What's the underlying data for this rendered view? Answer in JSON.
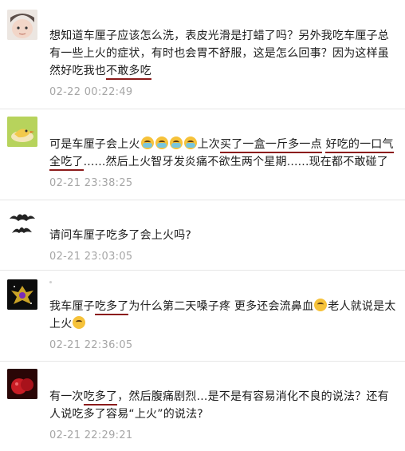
{
  "comments": [
    {
      "avatar": "baby-photo-avatar",
      "segments": [
        {
          "t": "想知道车厘子应该怎么洗，表皮光滑是打蜡了吗？另外我吃车厘子总有一些上火的症状，有时也会胃不舒服，这是怎么回事？因为这样虽然好吃我也"
        },
        {
          "t": "不敢多吃",
          "u": true
        }
      ],
      "time": "02-22 00:22:49"
    },
    {
      "avatar": "cartoon-bird-avatar",
      "segments": [
        {
          "t": "可是车厘子会上火"
        },
        {
          "emoji": "crying-face-icon"
        },
        {
          "emoji": "crying-face-icon"
        },
        {
          "emoji": "crying-face-icon"
        },
        {
          "emoji": "crying-face-icon"
        },
        {
          "t": "上次"
        },
        {
          "t": "买了一盒一斤多一点",
          "u": true
        },
        {
          "t": " "
        },
        {
          "t": "好吃的一口气全吃了",
          "u": true
        },
        {
          "t": "......然后上火智牙发炎痛不欲生两个星期......现在都不敢碰了"
        }
      ],
      "time": "02-21 23:38:25"
    },
    {
      "avatar": "bat-avatar",
      "segments": [
        {
          "t": "请问车厘子吃多了会上火吗?"
        }
      ],
      "time": "02-21 23:03:05"
    },
    {
      "avatar": "dark-emblem-avatar",
      "segments": [
        {
          "t": "我车厘子"
        },
        {
          "t": "吃多了",
          "u": true
        },
        {
          "t": "为什么第二天嗓子疼 更多还会流鼻血"
        },
        {
          "emoji": "nosebleed-face-icon"
        },
        {
          "t": "老人就说是太上火"
        },
        {
          "emoji": "sweating-face-icon"
        }
      ],
      "time": "02-21 22:36:05"
    },
    {
      "avatar": "cherries-avatar",
      "segments": [
        {
          "t": "有一次"
        },
        {
          "t": "吃多了",
          "u": true
        },
        {
          "t": "，然后腹痛剧烈...是不是有容易消化不良的说法？还有人说吃多了容易“上火”的说法?"
        }
      ],
      "time": "02-21 22:29:21"
    }
  ]
}
